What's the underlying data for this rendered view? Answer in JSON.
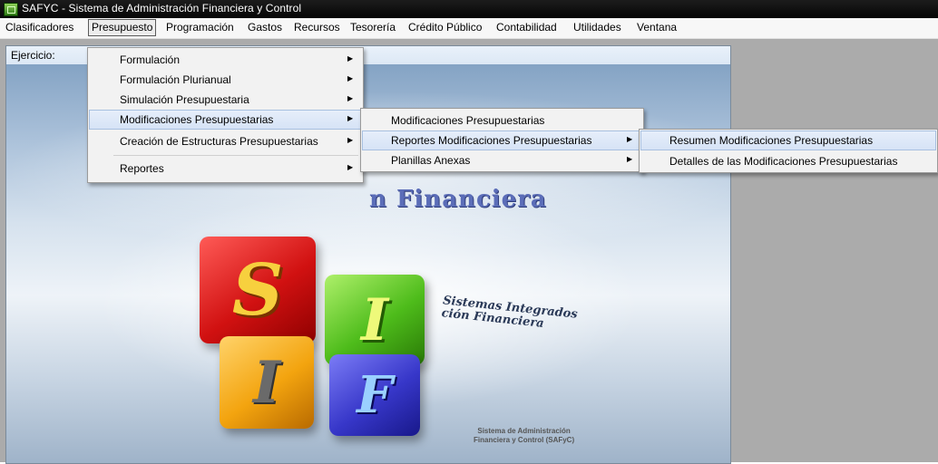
{
  "window": {
    "title": "SAFYC - Sistema de Administración Financiera y Control"
  },
  "menubar": {
    "items": [
      "Clasificadores",
      "Presupuesto",
      "Programación",
      "Gastos",
      "Recursos",
      "Tesorería",
      "Crédito Público",
      "Contabilidad",
      "Utilidades",
      "Ventana"
    ],
    "open_item": "Presupuesto"
  },
  "form": {
    "exercise_label": "Ejercicio:"
  },
  "presupuesto_menu": {
    "items": [
      {
        "label": "Formulación",
        "submenu": true
      },
      {
        "label": "Formulación Plurianual",
        "submenu": true
      },
      {
        "label": "Simulación Presupuestaria",
        "submenu": true
      },
      {
        "label": "Modificaciones Presupuestarias",
        "submenu": true,
        "highlighted": true
      },
      {
        "label": "Creación de Estructuras Presupuestarias",
        "submenu": true
      },
      {
        "label": "Reportes",
        "submenu": true
      }
    ]
  },
  "modificaciones_menu": {
    "items": [
      {
        "label": "Modificaciones Presupuestarias",
        "submenu": false
      },
      {
        "label": "Reportes Modificaciones Presupuestarias",
        "submenu": true,
        "highlighted": true
      },
      {
        "label": "Planillas Anexas",
        "submenu": true
      }
    ]
  },
  "reportes_menu": {
    "items": [
      {
        "label": "Resumen Modificaciones Presupuestarias",
        "highlighted": true
      },
      {
        "label": "Detalles de las Modificaciones Presupuestarias"
      }
    ]
  },
  "splash": {
    "heading": "n Financiera",
    "cube_letters": [
      "S",
      "I",
      "I",
      "F"
    ],
    "tagline": [
      "Sistemas Integrados",
      "ción Financiera"
    ],
    "footer": [
      "Sistema de Administración",
      "Financiera y Control (SAFyC)"
    ]
  },
  "colors": {
    "title_bar": "#0a0a0a",
    "menu_highlight": "#d6e3f6",
    "workspace": "#ababab",
    "cube_red": "#d11111",
    "cube_green": "#4ebc1b",
    "cube_yellow": "#f3a40f",
    "cube_blue": "#3737c9"
  }
}
